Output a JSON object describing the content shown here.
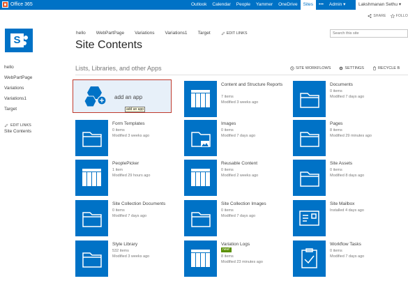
{
  "suitebar": {
    "brand": "Office 365",
    "nav": [
      "Outlook",
      "Calendar",
      "People",
      "Yammer",
      "OneDrive",
      "Sites",
      "•••",
      "Admin ▾"
    ],
    "active": "Sites",
    "user": "Lakshmanan Sethu ▾"
  },
  "actions": {
    "share": "SHARE",
    "follow": "FOLLO"
  },
  "topnav": {
    "items": [
      "hello",
      "WebPartPage",
      "Variations",
      "Variations1",
      "Target"
    ],
    "edit_links": "EDIT LINKS"
  },
  "search": {
    "placeholder": "Search this site"
  },
  "page_title": "Site Contents",
  "leftnav": {
    "items": [
      "hello",
      "WebPartPage",
      "Variations",
      "Variations1",
      "Target"
    ],
    "edit_links": "EDIT LINKS",
    "site_contents": "Site Contents"
  },
  "section_header": "Lists, Libraries, and other Apps",
  "commands": {
    "workflows": "SITE WORKFLOWS",
    "settings": "SETTINGS",
    "recycle": "RECYCLE B"
  },
  "add_app": {
    "label": "add an app",
    "tooltip": "add an app"
  },
  "tiles": [
    {
      "name": "Content and Structure Reports",
      "items": "7 items",
      "modified": "Modified 3 weeks ago"
    },
    {
      "name": "Documents",
      "items": "0 items",
      "modified": "Modified 7 days ago"
    },
    {
      "name": "Form Templates",
      "items": "0 items",
      "modified": "Modified 3 weeks ago"
    },
    {
      "name": "Images",
      "items": "0 items",
      "modified": "Modified 7 days ago"
    },
    {
      "name": "Pages",
      "items": "8 items",
      "modified": "Modified 29 minutes ago"
    },
    {
      "name": "PeoplePicker",
      "items": "1 item",
      "modified": "Modified 29 hours ago"
    },
    {
      "name": "Reusable Content",
      "items": "0 items",
      "modified": "Modified 2 weeks ago"
    },
    {
      "name": "Site Assets",
      "items": "0 items",
      "modified": "Modified 8 days ago"
    },
    {
      "name": "Site Collection Documents",
      "items": "0 items",
      "modified": "Modified 7 days ago"
    },
    {
      "name": "Site Collection Images",
      "items": "0 items",
      "modified": "Modified 7 days ago"
    },
    {
      "name": "Site Mailbox",
      "items": "Installed 4 days ago",
      "modified": ""
    },
    {
      "name": "Style Library",
      "items": "532 items",
      "modified": "Modified 3 weeks ago"
    },
    {
      "name": "Variation Logs",
      "badge": "new!",
      "items": "8 items",
      "modified": "Modified 23 minutes ago"
    },
    {
      "name": "Workflow Tasks",
      "items": "0 items",
      "modified": "Modified 7 days ago"
    }
  ],
  "icons": {
    "Content and Structure Reports": "list-icon",
    "Documents": "folder-icon",
    "Form Templates": "folder-icon",
    "Images": "image-library-icon",
    "Pages": "folder-icon",
    "PeoplePicker": "list-icon",
    "Reusable Content": "list-icon",
    "Site Assets": "folder-icon",
    "Site Collection Documents": "folder-icon",
    "Site Collection Images": "folder-icon",
    "Site Mailbox": "mailbox-icon",
    "Style Library": "folder-icon",
    "Variation Logs": "list-icon",
    "Workflow Tasks": "tasks-icon"
  },
  "colors": {
    "suitebar": "#0072c6",
    "tile": "#0072c6",
    "badge": "#5a8f00",
    "add_app_bg": "#e7f0f9"
  }
}
